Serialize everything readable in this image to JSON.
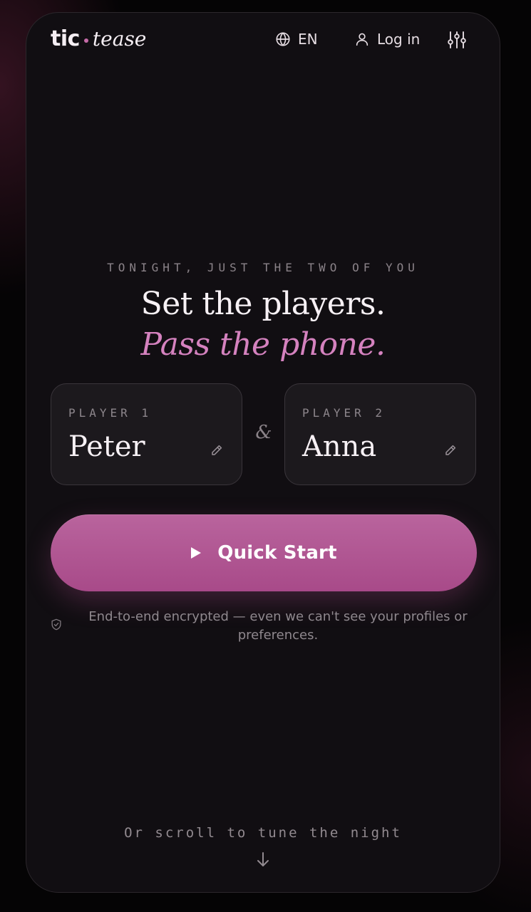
{
  "header": {
    "logo_primary": "tic",
    "logo_secondary": "tease",
    "language_label": "EN",
    "login_label": "Log in",
    "icons": {
      "language": "globe-icon",
      "login": "user-icon",
      "settings": "sliders-icon"
    }
  },
  "hero": {
    "eyebrow": "TONIGHT, JUST THE TWO OF YOU",
    "headline": "Set the players.",
    "subheadline": "Pass the phone."
  },
  "players": [
    {
      "label": "PLAYER 1",
      "name": "Peter"
    },
    {
      "label": "PLAYER 2",
      "name": "Anna"
    }
  ],
  "connector": "&",
  "quick_start": {
    "label": "Quick Start",
    "icon": "play-icon"
  },
  "privacy": {
    "text": "End-to-end encrypted — even we can't see your profiles or preferences.",
    "icon": "shield-icon"
  },
  "scroll_hint": {
    "text": "Or scroll to tune the night",
    "icon": "arrow-down-icon"
  },
  "colors": {
    "accent": "#c66ba8",
    "accent_text": "#d582bf",
    "button_top": "#b9649d",
    "button_bottom": "#a84a89",
    "surface": "#110e12",
    "card": "#1c191d"
  }
}
